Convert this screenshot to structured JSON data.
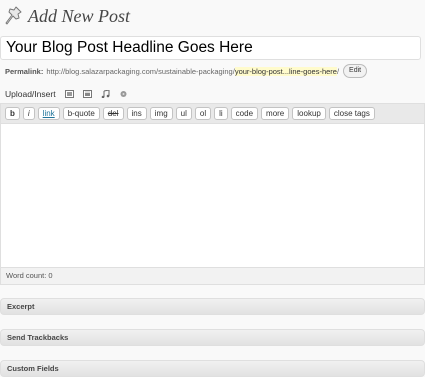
{
  "header": {
    "title": "Add New Post",
    "icon": "pushpin-icon"
  },
  "post": {
    "title_value": "Your Blog Post Headline Goes Here"
  },
  "permalink": {
    "label": "Permalink:",
    "base_url": "http://blog.salazarpackaging.com/sustainable-packaging/",
    "slug": "your-blog-post...line-goes-here",
    "trailing": "/",
    "edit_label": "Edit"
  },
  "upload": {
    "label": "Upload/Insert",
    "icons": [
      "image-icon",
      "video-icon",
      "audio-icon",
      "media-icon"
    ]
  },
  "toolbar": {
    "buttons": [
      "b",
      "i",
      "link",
      "b-quote",
      "del",
      "ins",
      "img",
      "ul",
      "ol",
      "li",
      "code",
      "more",
      "lookup",
      "close tags"
    ]
  },
  "editor": {
    "content": ""
  },
  "status": {
    "word_count": "Word count: 0"
  },
  "panels": {
    "excerpt": "Excerpt",
    "trackbacks": "Send Trackbacks",
    "custom_fields": "Custom Fields"
  },
  "colors": {
    "slug_highlight": "#fffbcc",
    "link": "#21759b"
  }
}
